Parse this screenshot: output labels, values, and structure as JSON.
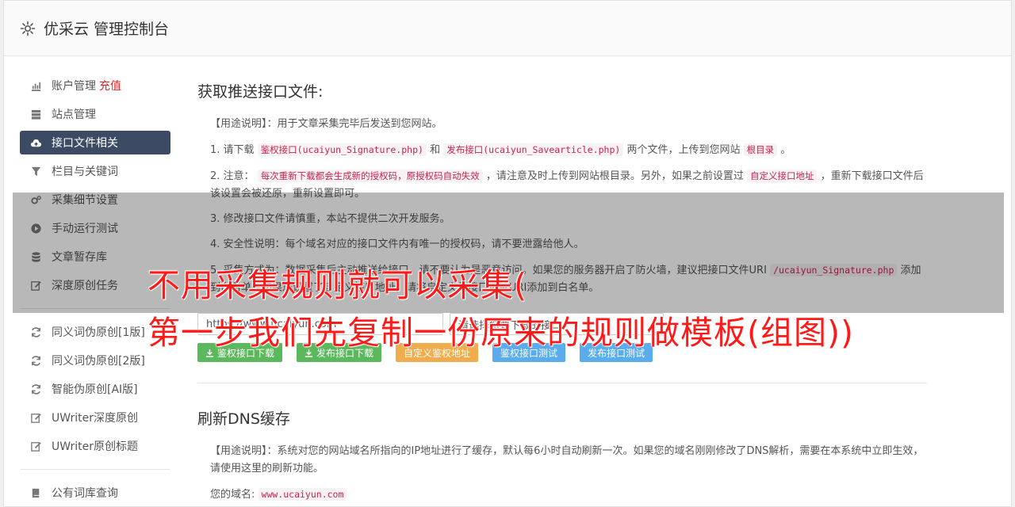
{
  "app": {
    "title": "优采云 管理控制台"
  },
  "sidebar": {
    "group1": [
      {
        "label": "账户管理",
        "extra": "充值",
        "icon": "bar-chart-icon"
      },
      {
        "label": "站点管理",
        "icon": "server-icon"
      },
      {
        "label": "接口文件相关",
        "icon": "cloud-upload-icon",
        "active": true
      },
      {
        "label": "栏目与关键词",
        "icon": "filter-icon"
      },
      {
        "label": "采集细节设置",
        "icon": "cogs-icon"
      },
      {
        "label": "手动运行测试",
        "icon": "play-circle-icon"
      },
      {
        "label": "文章暂存库",
        "icon": "database-icon"
      },
      {
        "label": "深度原创任务",
        "icon": "edit-icon"
      }
    ],
    "group2": [
      {
        "label": "同义词伪原创[1版]",
        "icon": "refresh-icon"
      },
      {
        "label": "同义词伪原创[2版]",
        "icon": "refresh-icon"
      },
      {
        "label": "智能伪原创[AI版]",
        "icon": "refresh-icon"
      },
      {
        "label": "UWriter深度原创",
        "icon": "edit-icon"
      },
      {
        "label": "UWriter原创标题",
        "icon": "edit-icon"
      }
    ],
    "group3": [
      {
        "label": "公有词库查询",
        "icon": "book-icon"
      }
    ]
  },
  "section1": {
    "title": "获取推送接口文件:",
    "usage": "【用途说明】：用于文章采集完毕后发送到您网站。",
    "step1": {
      "prefix": "1. 请下载",
      "code1": "鉴权接口(ucaiyun_Signature.php)",
      "mid": "和",
      "code2": "发布接口(ucaiyun_Savearticle.php)",
      "suffix": "两个文件，上传到您网站",
      "code3": "根目录",
      "end": "。"
    },
    "step2": {
      "prefix": "2. 注意：",
      "code1": "每次重新下载都会生成新的授权码，原授权码自动失效",
      "mid": "，请注意及时上传到网站根目录。另外，如果之前设置过",
      "code2": "自定义接口地址",
      "suffix": "，重新下载接口文件后该设置会被还原，重新设置即可。"
    },
    "step3": "3. 修改接口文件请慎重，本站不提供二次开发服务。",
    "step4": "4. 安全性说明：每个域名对应的接口文件内有唯一的授权码，请不要泄露给他人。",
    "step5": {
      "prefix": "5. 采集方式为：数据采集后主动推送给接口，请不要认为是恶意访问。如果您的服务器开启了防火墙，建议把接口文件URI",
      "code1": "/ucaiyun_Signature.php",
      "suffix": "添加到白名单，如果您设置了自定义接口地址，请将自定义的接口地址URI添加到白名单。"
    },
    "input1": "https://www.ucaiyun.com",
    "input2": "请选择您要下载的接口",
    "buttons": {
      "sig_download": "鉴权接口下载",
      "pub_download": "发布接口下载",
      "custom_sig": "自定义鉴权地址",
      "sig_test": "鉴权接口测试",
      "pub_test": "发布接口测试"
    }
  },
  "section2": {
    "title": "刷新DNS缓存",
    "usage": "【用途说明】：系统对您的网站域名所指向的IP地址进行了缓存，默认每6小时自动刷新一次。如果您的域名刚刚修改了DNS解析，需要在本系统中立即生效，请使用这里的刷新功能。",
    "domain_label": "您的域名:",
    "domain_value": "www.ucaiyun.com"
  },
  "overlay": {
    "line1": "不用采集规则就可以采集(",
    "line2": "第一步我们先复制一份原来的规则做模板(组图))"
  },
  "colors": {
    "active_nav": "#3c4b63",
    "recharge": "#e02222",
    "headline": "#ff1a1a",
    "green": "#5cb85c",
    "orange": "#f0ad4e",
    "blue": "#5aacec"
  }
}
